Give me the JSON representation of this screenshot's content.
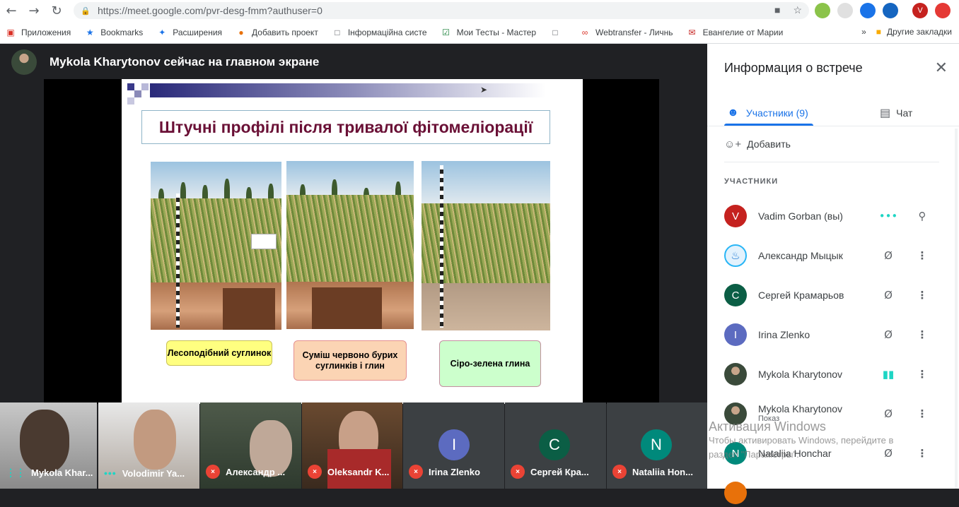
{
  "browser": {
    "url_host": "https://meet.google.com/",
    "url_path": "pvr-desg-fmm?authuser=0",
    "bookmarks": [
      "Приложения",
      "Bookmarks",
      "Расширения",
      "Добавить проект",
      "Інформаційна систе",
      "Мои Тесты - Мастер",
      "Webtransfer - Личнь",
      "Евангелие от Марии"
    ],
    "other_bookmarks": "Другие закладки",
    "profile_letter": "V"
  },
  "presenter": {
    "banner": "Mykola Kharytonov сейчас на главном экране"
  },
  "slide": {
    "title": "Штучні профілі після тривалої фітомеліорації",
    "labels": [
      "Лесоподібний суглинок",
      "Суміш червоно бурих суглинків і глин",
      "Сіро-зелена глина"
    ],
    "colors": {
      "label1": "#ffff80",
      "label2": "#fbd4b4",
      "label3": "#ccffcc",
      "title": "#6a1036"
    }
  },
  "tiles": [
    {
      "name": "Mykola Khar..."
    },
    {
      "name": "Volodimir Ya..."
    },
    {
      "name": "Александр ..."
    },
    {
      "name": "Oleksandr K..."
    },
    {
      "name": "Irina Zlenko",
      "letter": "I"
    },
    {
      "name": "Сергей Кра...",
      "letter": "С"
    },
    {
      "name": "Nataliia Hon...",
      "letter": "N"
    }
  ],
  "panel": {
    "title": "Информация о встрече",
    "tab_people": "Участники (9)",
    "tab_chat": "Чат",
    "add": "Добавить",
    "section": "УЧАСТНИКИ",
    "participants": [
      {
        "letter": "V",
        "name": "Vadim Gorban (вы)"
      },
      {
        "letter": "",
        "name": "Александр Мыцык"
      },
      {
        "letter": "С",
        "name": "Сергей Крамарьов"
      },
      {
        "letter": "I",
        "name": "Irina Zlenko"
      },
      {
        "letter": "",
        "name": "Mykola Kharytonov"
      },
      {
        "letter": "",
        "name": "Mykola Kharytonov",
        "sub": "Показ"
      },
      {
        "letter": "N",
        "name": "Nataliia Honchar"
      }
    ]
  },
  "watermark": {
    "title": "Активация Windows",
    "line1": "Чтобы активировать Windows, перейдите в",
    "line2": "раздел \"Параметры\"."
  }
}
